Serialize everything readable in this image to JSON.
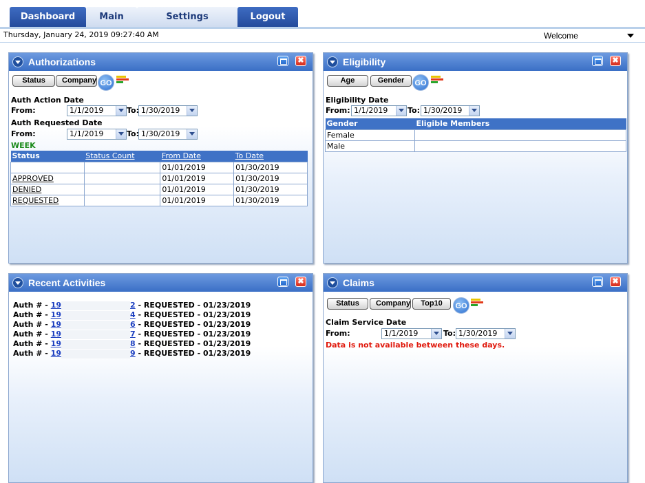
{
  "nav": {
    "tabs": [
      {
        "label": "Dashboard"
      },
      {
        "label": "Main"
      },
      {
        "label": "Settings"
      },
      {
        "label": "Logout"
      }
    ]
  },
  "header": {
    "datetime": "Thursday, January 24, 2019 09:27:40 AM",
    "welcome": "Welcome"
  },
  "authorizations": {
    "title": "Authorizations",
    "buttons": {
      "status": "Status",
      "company": "Company",
      "go": "GO"
    },
    "action_date_label": "Auth Action Date",
    "requested_date_label": "Auth Requested Date",
    "from_label": "From:",
    "to_label": "To:",
    "action_from": "1/1/2019",
    "action_to": "1/30/2019",
    "requested_from": "1/1/2019",
    "requested_to": "1/30/2019",
    "period": "WEEK",
    "columns": [
      "Status",
      "Status Count",
      "From Date",
      "To Date"
    ],
    "rows": [
      {
        "status": "",
        "count": "",
        "from": "01/01/2019",
        "to": "01/30/2019"
      },
      {
        "status": "APPROVED",
        "count": "",
        "from": "01/01/2019",
        "to": "01/30/2019"
      },
      {
        "status": "DENIED",
        "count": "",
        "from": "01/01/2019",
        "to": "01/30/2019"
      },
      {
        "status": "REQUESTED",
        "count": "",
        "from": "01/01/2019",
        "to": "01/30/2019"
      }
    ]
  },
  "eligibility": {
    "title": "Eligibility",
    "buttons": {
      "age": "Age",
      "gender": "Gender",
      "go": "GO"
    },
    "date_label": "Eligibility Date",
    "from_label": "From:",
    "to_label": "To:",
    "from": "1/1/2019",
    "to": "1/30/2019",
    "columns": [
      "Gender",
      "Eligible Members"
    ],
    "rows": [
      {
        "gender": "Female",
        "members": ""
      },
      {
        "gender": "Male",
        "members": ""
      }
    ]
  },
  "recent": {
    "title": "Recent Activities",
    "items": [
      {
        "prefix": "Auth # - ",
        "id_start": "19",
        "id_end": "2",
        "text": " - REQUESTED - 01/23/2019"
      },
      {
        "prefix": "Auth # - ",
        "id_start": "19",
        "id_end": "4",
        "text": " - REQUESTED - 01/23/2019"
      },
      {
        "prefix": "Auth # - ",
        "id_start": "19",
        "id_end": "6",
        "text": " - REQUESTED - 01/23/2019"
      },
      {
        "prefix": "Auth # - ",
        "id_start": "19",
        "id_end": "7",
        "text": " - REQUESTED - 01/23/2019"
      },
      {
        "prefix": "Auth # - ",
        "id_start": "19",
        "id_end": "8",
        "text": " - REQUESTED - 01/23/2019"
      },
      {
        "prefix": "Auth # - ",
        "id_start": "19",
        "id_end": "9",
        "text": " - REQUESTED - 01/23/2019"
      }
    ]
  },
  "claims": {
    "title": "Claims",
    "buttons": {
      "status": "Status",
      "company": "Company",
      "top10": "Top10",
      "go": "GO"
    },
    "date_label": "Claim Service Date",
    "from_label": "From:",
    "to_label": "To:",
    "from": "1/1/2019",
    "to": "1/30/2019",
    "error": "Data is not available between these days."
  },
  "colors": {
    "header_blue": "#3a6fc6",
    "error_red": "#e0180c",
    "week_green": "#1a8a1a"
  }
}
